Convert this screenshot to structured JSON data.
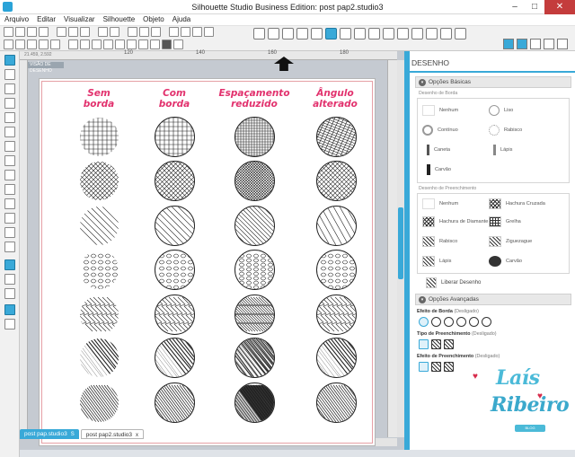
{
  "window": {
    "title": "Silhouette Studio Business Edition: post pap2.studio3"
  },
  "menu": [
    "Arquivo",
    "Editar",
    "Visualizar",
    "Silhouette",
    "Objeto",
    "Ajuda"
  ],
  "canvas": {
    "coords": "21.459, 2.592",
    "view_label": "VISÃO DE DESENHO",
    "ruler_numbers": [
      "120",
      "140",
      "160",
      "180"
    ],
    "columns": [
      {
        "line1": "Sem",
        "line2": "borda"
      },
      {
        "line1": "Com",
        "line2": "borda"
      },
      {
        "line1": "Espaçamento",
        "line2": "reduzido"
      },
      {
        "line1": "Ângulo",
        "line2": "alterado"
      }
    ]
  },
  "tabs": [
    {
      "label": "post pap.studio3",
      "badge": "S"
    },
    {
      "label": "post pap2.studio3",
      "close": "x"
    }
  ],
  "panel": {
    "title": "DESENHO",
    "basic_section": "Opções Básicas",
    "border_group_label": "Desenho de Borda",
    "border_options": [
      "Nenhum",
      "Liso",
      "Contínuo",
      "Rabisco",
      "Caneta",
      "Lápis",
      "Carvão"
    ],
    "fill_group_label": "Desenho de Preenchimento",
    "fill_options": [
      "Nenhum",
      "Hachura Cruzada",
      "Hachura de Diamante",
      "Grelha",
      "Rabisco",
      "Ziguezague",
      "Lápis",
      "Carvão"
    ],
    "release_button": "Liberar Desenho",
    "advanced_section": "Opções Avançadas",
    "border_effect": {
      "label": "Efeito de Borda",
      "state": "(Desligado)"
    },
    "fill_type": {
      "label": "Tipo de Preenchimento",
      "state": "(Desligado)"
    },
    "fill_effect": {
      "label": "Efeito de Preenchimento",
      "state": "(Desligado)"
    }
  },
  "watermark": {
    "line1": "Laís",
    "line2": "Ribeiro",
    "tag": "BLOG"
  },
  "colors": {
    "accent": "#39a9d8",
    "heading_pink": "#e2326e"
  }
}
